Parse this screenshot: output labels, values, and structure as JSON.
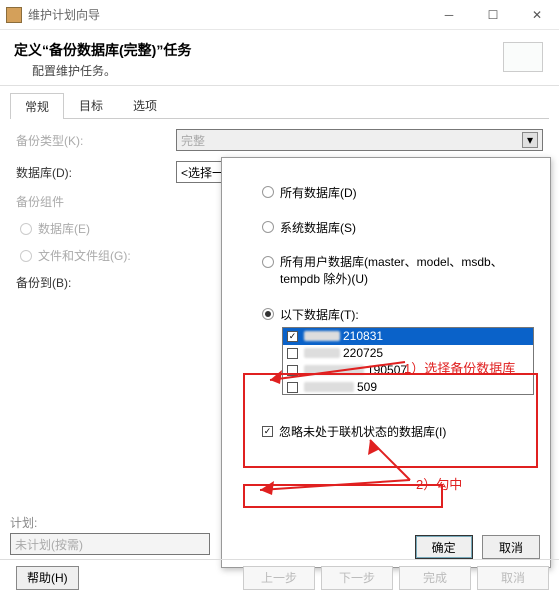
{
  "window": {
    "title": "维护计划向导"
  },
  "header": {
    "title": "定义“备份数据库(完整)”任务",
    "subtitle": "配置维护任务。"
  },
  "tabs": [
    {
      "label": "常规",
      "active": true
    },
    {
      "label": "目标",
      "active": false
    },
    {
      "label": "选项",
      "active": false
    }
  ],
  "form": {
    "backup_type_label": "备份类型(K):",
    "backup_type_value": "完整",
    "database_label": "数据库(D):",
    "database_value": "<选择一项或多项>",
    "component_label": "备份组件",
    "comp_db_label": "数据库(E)",
    "comp_files_label": "文件和文件组(G):",
    "backup_to_label": "备份到(B):"
  },
  "popup": {
    "opt_all": "所有数据库(D)",
    "opt_sys": "系统数据库(S)",
    "opt_user": "所有用户数据库(master、model、msdb、tempdb 除外)(U)",
    "opt_these": "以下数据库(T):",
    "items": [
      {
        "text": "210831",
        "checked": true,
        "selected": true
      },
      {
        "text": "220725",
        "checked": false,
        "selected": false
      },
      {
        "text": "190507",
        "checked": false,
        "selected": false
      },
      {
        "text": "509",
        "checked": false,
        "selected": false
      }
    ],
    "ignore_offline": "忽略未处于联机状态的数据库(I)",
    "ok": "确定",
    "cancel": "取消"
  },
  "annotations": {
    "a1": "1）选择备份数据库",
    "a2": "2）勾中"
  },
  "plan": {
    "label": "计划:",
    "value": "未计划(按需)"
  },
  "footer": {
    "help": "帮助(H)",
    "back": "上一步",
    "next": "下一步",
    "finish": "完成",
    "cancel": "取消"
  }
}
